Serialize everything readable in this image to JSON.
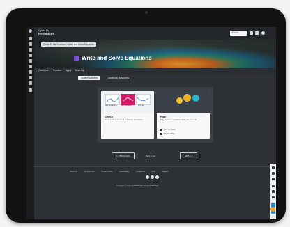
{
  "app": {
    "brand_line1": "Open Up",
    "brand_line2": "Resources"
  },
  "search": {
    "placeholder": "Search"
  },
  "breadcrumb": "Grade 8 Unit 4 Lesson 2 Write and Solve Equations",
  "lesson": {
    "title": "Write and Solve Equations"
  },
  "nav_tabs": [
    "Overview",
    "Practice",
    "Apply",
    "Wrap Up"
  ],
  "sub_tabs": {
    "active": "Student Activities",
    "inactive": "Additional Resources"
  },
  "cards": [
    {
      "name": "Check",
      "description": "Practice what students learned in the lesson.",
      "thumb_labels": [
        "Unit Introduction",
        "Unit Overview",
        "Unit Test"
      ]
    },
    {
      "name": "Play",
      "description": "Play a game to practice what you learned.",
      "options": [
        "Play as Class",
        "Student Play"
      ]
    }
  ],
  "pager": {
    "previous": "< PREVIOUS",
    "next": "NEXT >",
    "back_to_top": "Back to top"
  },
  "footer": {
    "links": [
      "About Us",
      "Terms of Use",
      "Privacy Policy",
      "Accessibility",
      "Contact Us",
      "FAQ",
      "Support"
    ],
    "copyright": "Copyright © Open Up Resources. All rights reserved."
  },
  "colors": {
    "accent_purple": "#7b4fd6",
    "thumb_pink": "#d6186b",
    "chat_orange": "#f2a22a",
    "panel_dark": "#2d3136"
  }
}
